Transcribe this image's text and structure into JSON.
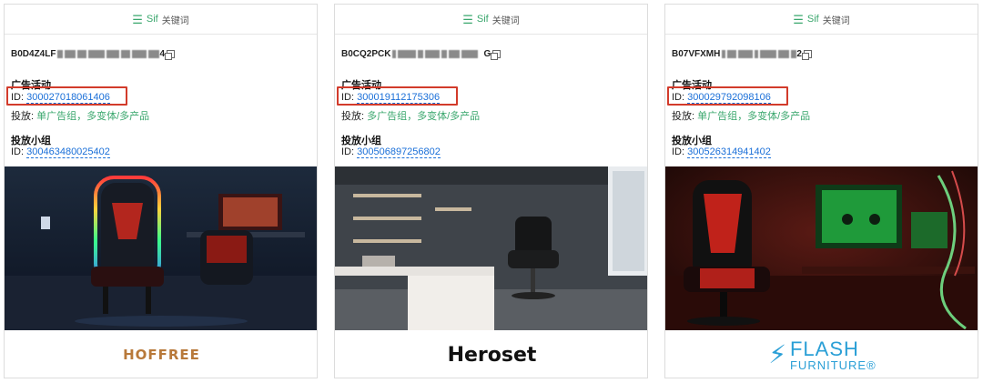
{
  "header": {
    "icon": "list-icon",
    "label": "Sif",
    "sub": "关键词"
  },
  "labels": {
    "campaign": "广告活动",
    "id_prefix": "ID:",
    "placement_prefix": "投放:",
    "ad_group": "投放小组"
  },
  "cards": [
    {
      "asin_prefix": "B0D4Z4LF",
      "asin_suffix": "4",
      "campaign_id": "300027018061406",
      "placement": "单广告组，多变体/多产品",
      "ad_group_id": "300463480025402",
      "brand": "HOFFREE"
    },
    {
      "asin_prefix": "B0CQ2PCK",
      "asin_suffix": "G",
      "campaign_id": "300019112175306",
      "placement": "多广告组，多变体/多产品",
      "ad_group_id": "300506897256802",
      "brand": "Heroset"
    },
    {
      "asin_prefix": "B07VFXMH",
      "asin_suffix": "2",
      "campaign_id": "300029792098106",
      "placement": "单广告组，多变体/多产品",
      "ad_group_id": "300526314941402",
      "brand": "FLASH",
      "brand_sub": "FURNITURE®"
    }
  ],
  "colors": {
    "accent_green": "#3aa76d",
    "link_blue": "#1a6fd8",
    "highlight_red": "#d23b2b"
  }
}
